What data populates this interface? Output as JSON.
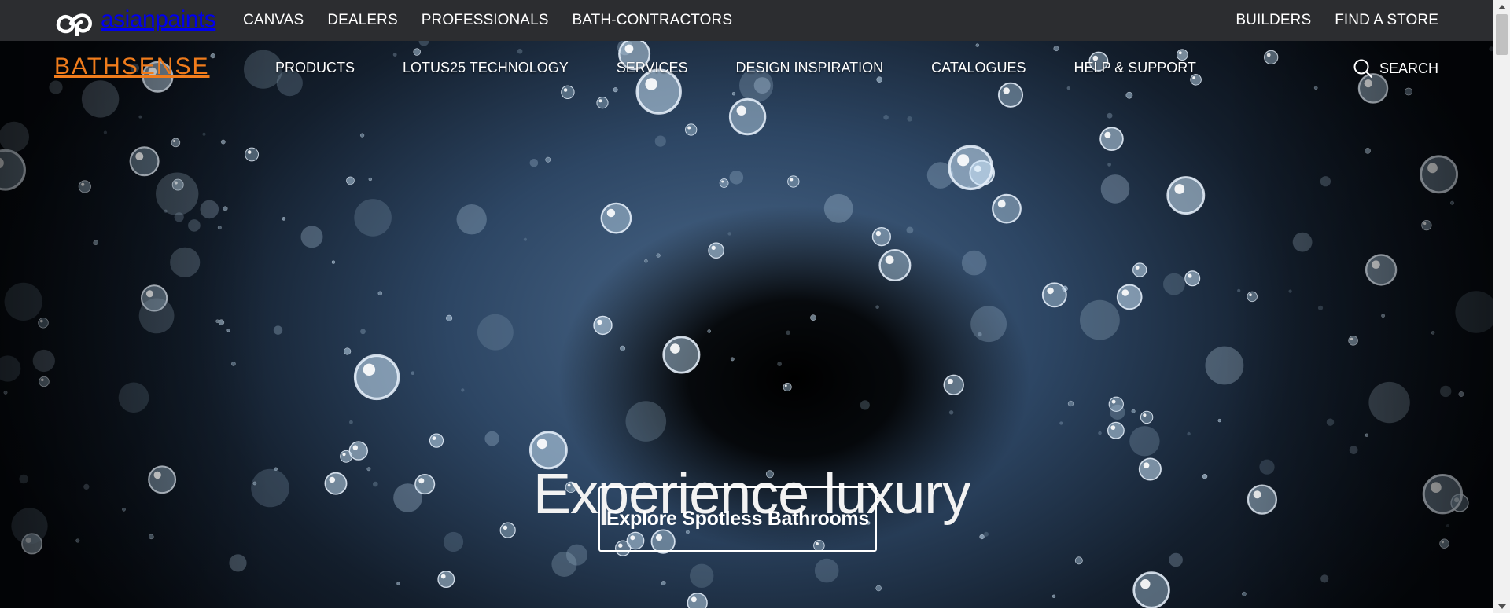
{
  "topbar": {
    "logo_text": "asianpaints",
    "left_links": [
      "CANVAS",
      "DEALERS",
      "PROFESSIONALS",
      "BATH-CONTRACTORS"
    ],
    "right_links": [
      "BUILDERS",
      "FIND A STORE"
    ]
  },
  "header": {
    "brand": "BATHSENSE",
    "nav": [
      "PRODUCTS",
      "LOTUS25 TECHNOLOGY",
      "SERVICES",
      "DESIGN INSPIRATION",
      "CATALOGUES",
      "HELP & SUPPORT"
    ],
    "search_label": "SEARCH"
  },
  "hero": {
    "headline": "Experience luxury",
    "cta_label": "Explore Spotless Bathrooms",
    "background": "water droplets splash"
  },
  "colors": {
    "topbar_bg": "#2c2d30",
    "brand_orange": "#f07c1c",
    "text": "#ffffff"
  },
  "icons": [
    "asianpaints-logo-icon",
    "search-icon",
    "scroll-up-icon",
    "scroll-down-icon"
  ]
}
